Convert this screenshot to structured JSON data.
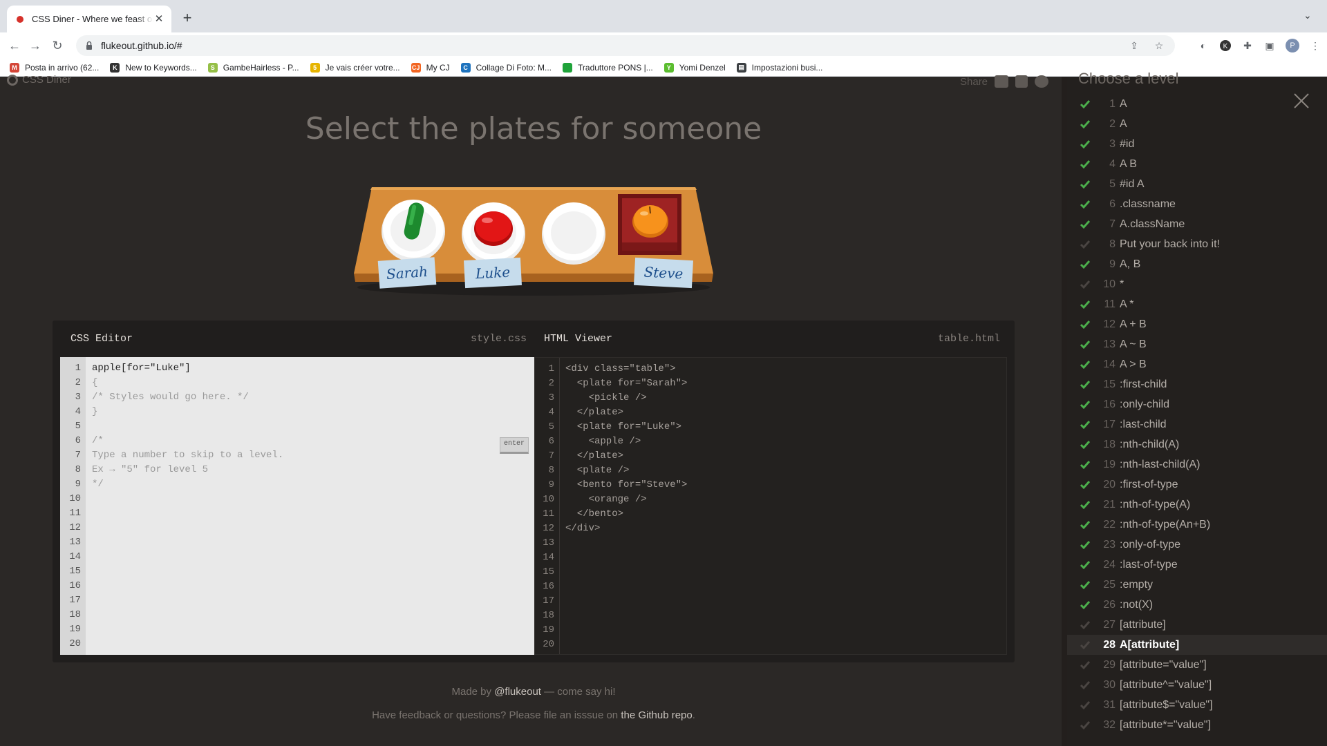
{
  "browser": {
    "tab_title": "CSS Diner - Where we feast on CSS",
    "url": "flukeout.github.io/#",
    "avatar_letter": "P",
    "bookmarks": [
      {
        "label": "Posta in arrivo (62...",
        "icon": "gmail-icon",
        "color": "#d44638",
        "glyph": "M"
      },
      {
        "label": "New to Keywords...",
        "icon": "keywords-icon",
        "color": "#333333",
        "glyph": "K"
      },
      {
        "label": "GambeHairless - P...",
        "icon": "shopify-icon",
        "color": "#95bf47",
        "glyph": "S"
      },
      {
        "label": "Je vais créer votre...",
        "icon": "fiverr-icon",
        "color": "#e6b400",
        "glyph": "5"
      },
      {
        "label": "My CJ",
        "icon": "cj-icon",
        "color": "#f26522",
        "glyph": "CJ"
      },
      {
        "label": "Collage Di Foto: M...",
        "icon": "collage-icon",
        "color": "#1e73be",
        "glyph": "C"
      },
      {
        "label": "Traduttore PONS |...",
        "icon": "pons-icon",
        "color": "#1fa33a",
        "glyph": ""
      },
      {
        "label": "Yomi Denzel",
        "icon": "yomi-icon",
        "color": "#5bbd2f",
        "glyph": "Y"
      },
      {
        "label": "Impostazioni busi...",
        "icon": "business-icon",
        "color": "#3c4043",
        "glyph": "▤"
      }
    ]
  },
  "header": {
    "logo_text": "CSS Diner",
    "share_label": "Share",
    "instruction": "Select the plates for someone"
  },
  "scene": {
    "plates": [
      {
        "name_tag": "Sarah",
        "item": "pickle",
        "container": "plate"
      },
      {
        "name_tag": "Luke",
        "item": "apple",
        "container": "plate"
      },
      {
        "name_tag": "",
        "item": "",
        "container": "plate"
      },
      {
        "name_tag": "Steve",
        "item": "orange",
        "container": "bento"
      }
    ]
  },
  "css_editor": {
    "title": "CSS Editor",
    "filename": "style.css",
    "enter_label": "enter",
    "lines": [
      "apple[for=\"Luke\"]",
      "{",
      "/* Styles would go here. */",
      "}",
      "",
      "/*",
      "Type a number to skip to a level.",
      "Ex → \"5\" for level 5",
      "*/"
    ],
    "line_numbers": [
      "1",
      "2",
      "3",
      "4",
      "5",
      "6",
      "7",
      "8",
      "9",
      "10",
      "11",
      "12",
      "13",
      "14",
      "15",
      "16",
      "17",
      "18",
      "19",
      "20"
    ]
  },
  "html_viewer": {
    "title": "HTML Viewer",
    "filename": "table.html",
    "lines": [
      "<div class=\"table\">",
      "  <plate for=\"Sarah\">",
      "    <pickle />",
      "  </plate>",
      "  <plate for=\"Luke\">",
      "    <apple />",
      "  </plate>",
      "  <plate />",
      "  <bento for=\"Steve\">",
      "    <orange />",
      "  </bento>",
      "</div>"
    ],
    "line_numbers": [
      "1",
      "2",
      "3",
      "4",
      "5",
      "6",
      "7",
      "8",
      "9",
      "10",
      "11",
      "12",
      "13",
      "14",
      "15",
      "16",
      "17",
      "18",
      "19",
      "20"
    ]
  },
  "footer": {
    "made_by_prefix": "Made by ",
    "made_by_link": "@flukeout",
    "made_by_suffix": " — come say hi!",
    "feedback_prefix": "Have feedback or questions? Please file an isssue on ",
    "feedback_link": "the Github repo",
    "feedback_suffix": "."
  },
  "levels_panel": {
    "title": "Choose a level",
    "selected_level": 28,
    "levels": [
      {
        "num": "1",
        "name": "A",
        "done": true
      },
      {
        "num": "2",
        "name": "A",
        "done": true
      },
      {
        "num": "3",
        "name": "#id",
        "done": true
      },
      {
        "num": "4",
        "name": "A B",
        "done": true
      },
      {
        "num": "5",
        "name": "#id A",
        "done": true
      },
      {
        "num": "6",
        "name": ".classname",
        "done": true
      },
      {
        "num": "7",
        "name": "A.className",
        "done": true
      },
      {
        "num": "8",
        "name": "Put your back into it!",
        "done": false
      },
      {
        "num": "9",
        "name": "A, B",
        "done": true
      },
      {
        "num": "10",
        "name": "*",
        "done": false
      },
      {
        "num": "11",
        "name": "A *",
        "done": true
      },
      {
        "num": "12",
        "name": "A + B",
        "done": true
      },
      {
        "num": "13",
        "name": "A ~ B",
        "done": true
      },
      {
        "num": "14",
        "name": "A > B",
        "done": true
      },
      {
        "num": "15",
        "name": ":first-child",
        "done": true
      },
      {
        "num": "16",
        "name": ":only-child",
        "done": true
      },
      {
        "num": "17",
        "name": ":last-child",
        "done": true
      },
      {
        "num": "18",
        "name": ":nth-child(A)",
        "done": true
      },
      {
        "num": "19",
        "name": ":nth-last-child(A)",
        "done": true
      },
      {
        "num": "20",
        "name": ":first-of-type",
        "done": true
      },
      {
        "num": "21",
        "name": ":nth-of-type(A)",
        "done": true
      },
      {
        "num": "22",
        "name": ":nth-of-type(An+B)",
        "done": true
      },
      {
        "num": "23",
        "name": ":only-of-type",
        "done": true
      },
      {
        "num": "24",
        "name": ":last-of-type",
        "done": true
      },
      {
        "num": "25",
        "name": ":empty",
        "done": true
      },
      {
        "num": "26",
        "name": ":not(X)",
        "done": true
      },
      {
        "num": "27",
        "name": "[attribute]",
        "done": false
      },
      {
        "num": "28",
        "name": "A[attribute]",
        "done": false
      },
      {
        "num": "29",
        "name": "[attribute=\"value\"]",
        "done": false
      },
      {
        "num": "30",
        "name": "[attribute^=\"value\"]",
        "done": false
      },
      {
        "num": "31",
        "name": "[attribute$=\"value\"]",
        "done": false
      },
      {
        "num": "32",
        "name": "[attribute*=\"value\"]",
        "done": false
      }
    ]
  },
  "colors": {
    "check_done": "#4cae4c",
    "check_todo": "#4a4542",
    "table_wood": "#d88d3a",
    "bento": "#8a1f1f"
  }
}
